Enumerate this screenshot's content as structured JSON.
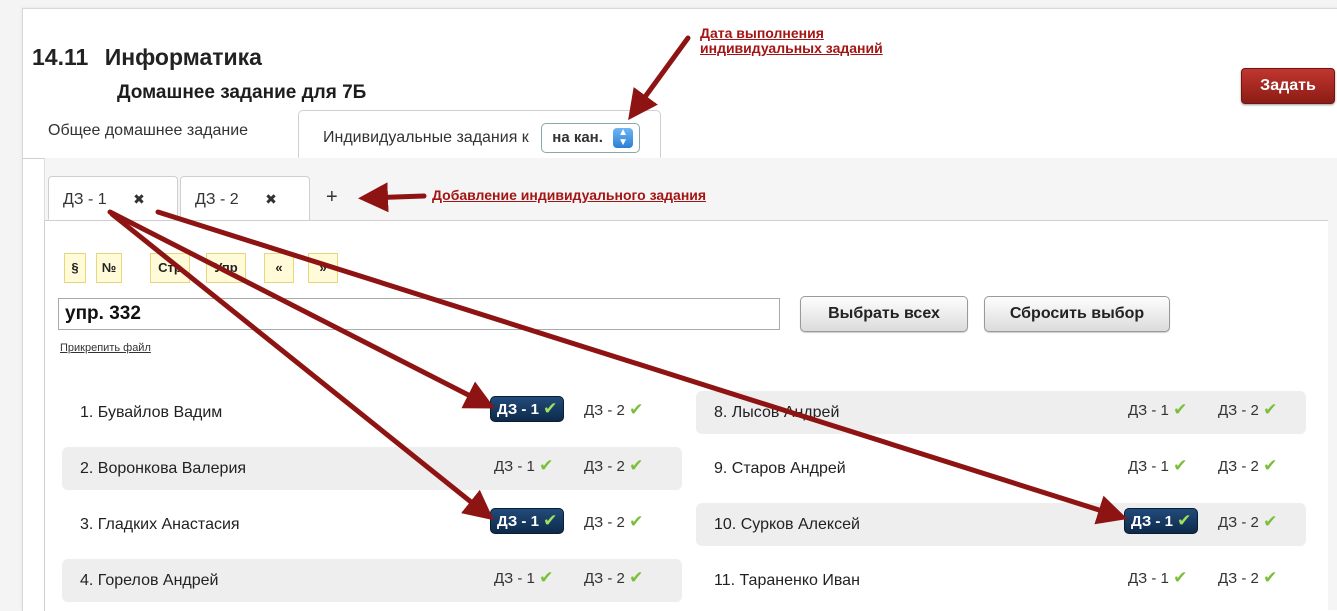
{
  "header": {
    "date": "14.11",
    "subject": "Информатика",
    "subtitle": "Домашнее задание для 7Б",
    "assign_button": "Задать"
  },
  "annotations": {
    "date_note_line1": "Дата выполнения",
    "date_note_line2": "индивидуальных заданий",
    "add_note": "Добавление индивидуального задания"
  },
  "main_tabs": {
    "general": "Общее домашнее задание",
    "individual": "Индивидуальные задания к",
    "selector_value": "на кан."
  },
  "sub_tabs": {
    "tab1": "ДЗ - 1",
    "tab2": "ДЗ - 2",
    "close": "✖",
    "add": "+"
  },
  "toolbar": [
    "§",
    "№",
    "Стр",
    "Упр",
    "«",
    "»"
  ],
  "task": {
    "value": "упр. 332",
    "select_all": "Выбрать всех",
    "reset": "Сбросить выбор",
    "attach": "Прикрепить файл"
  },
  "hw_labels": {
    "hw1": "ДЗ - 1",
    "hw2": "ДЗ - 2",
    "check": "✔"
  },
  "students_left": [
    {
      "name": "1. Бувайлов Вадим",
      "hw1_selected": true
    },
    {
      "name": "2. Воронкова Валерия",
      "hw1_selected": false
    },
    {
      "name": "3. Гладких Анастасия",
      "hw1_selected": true
    },
    {
      "name": "4. Горелов Андрей",
      "hw1_selected": false
    }
  ],
  "students_right": [
    {
      "name": "8. Лысов Андрей",
      "hw1_selected": false
    },
    {
      "name": "9. Старов Андрей",
      "hw1_selected": false
    },
    {
      "name": "10. Сурков Алексей",
      "hw1_selected": true
    },
    {
      "name": "11. Тараненко Иван",
      "hw1_selected": false
    }
  ],
  "colors": {
    "arrow": "#8e1414",
    "selected_badge": "#163a63",
    "check": "#7bbf3a",
    "assign_button": "#a8281f"
  }
}
